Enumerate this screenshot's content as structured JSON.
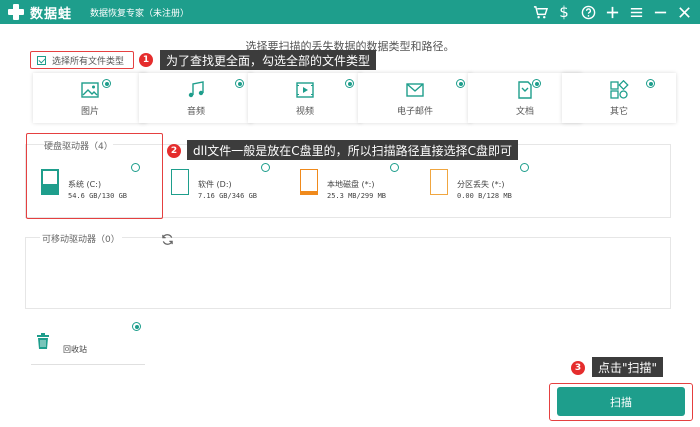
{
  "app": {
    "name": "数据蛙",
    "subtitle": "数据恢复专家（未注册）"
  },
  "toolbar_icons": [
    "cart-icon",
    "dollar-icon",
    "question-icon",
    "plus-icon",
    "menu-icon",
    "minimize-icon",
    "close-icon"
  ],
  "instruction": "选择要扫描的丢失数据的数据类型和路径。",
  "select_all": {
    "label": "选择所有文件类型",
    "checked": true
  },
  "file_types": [
    {
      "label": "图片",
      "icon": "image-icon",
      "selected": true
    },
    {
      "label": "音频",
      "icon": "music-icon",
      "selected": true
    },
    {
      "label": "视频",
      "icon": "video-icon",
      "selected": true
    },
    {
      "label": "电子邮件",
      "icon": "email-icon",
      "selected": true
    },
    {
      "label": "文档",
      "icon": "document-icon",
      "selected": true
    },
    {
      "label": "其它",
      "icon": "other-icon",
      "selected": true
    }
  ],
  "hard_drives": {
    "title": "硬盘驱动器（4）",
    "drives": [
      {
        "name": "系统 (C:)",
        "size": "54.6 GB/130 GB",
        "used_fraction": 0.42,
        "color": "#1e9e8c",
        "selected": false
      },
      {
        "name": "软件 (D:)",
        "size": "7.16 GB/346 GB",
        "used_fraction": 0.02,
        "color": "#1e9e8c",
        "selected": false
      },
      {
        "name": "本地磁盘 (*:)",
        "size": "25.3 MB/299 MB",
        "used_fraction": 0.12,
        "color": "#f08a1c",
        "selected": false
      },
      {
        "name": "分区丢失 (*:)",
        "size": "0.00  B/128 MB",
        "used_fraction": 0.0,
        "color": "#f0a640",
        "selected": false
      }
    ]
  },
  "removable_drives": {
    "title": "可移动驱动器（0）"
  },
  "recycle_bin": {
    "label": "回收站",
    "selected": true
  },
  "scan_button": "扫描",
  "tips": [
    {
      "number": "1",
      "text": "为了查找更全面，勾选全部的文件类型"
    },
    {
      "number": "2",
      "text": "dll文件一般是放在C盘里的，所以扫描路径直接选择C盘即可"
    },
    {
      "number": "3",
      "text": "点击\"扫描\""
    }
  ],
  "colors": {
    "accent": "#1e9e8c",
    "highlight": "#e54040",
    "tip_bg": "#3c3c3c"
  }
}
